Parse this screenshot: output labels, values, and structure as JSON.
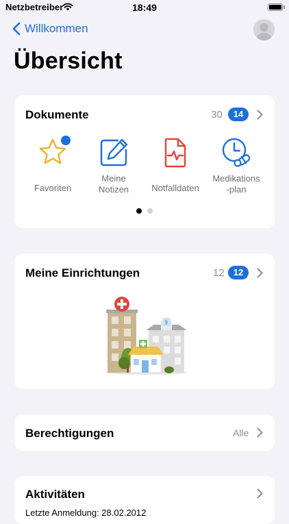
{
  "status": {
    "carrier": "Netzbetreiber",
    "time": "18:49"
  },
  "nav": {
    "back_label": "Willkommen"
  },
  "page": {
    "title": "Übersicht"
  },
  "documents": {
    "title": "Dokumente",
    "count": "30",
    "badge": "14",
    "tiles": [
      {
        "label": "Favoriten",
        "icon": "star-icon"
      },
      {
        "label": "Meine Notizen",
        "icon": "note-edit-icon"
      },
      {
        "label": "Notfalldaten",
        "icon": "emergency-document-icon"
      },
      {
        "label": "Medikations-plan",
        "icon": "medication-plan-icon"
      }
    ],
    "page_indicator": {
      "pages": 2,
      "current": 1
    }
  },
  "facilities": {
    "title": "Meine Einrichtungen",
    "count": "12",
    "badge": "12"
  },
  "permissions": {
    "title": "Berechtigungen",
    "value": "Alle"
  },
  "activities": {
    "title": "Aktivitäten",
    "last_login": "Letzte Anmeldung: 28.02.2012"
  },
  "colors": {
    "accent": "#1d6fd9",
    "emergency": "#e0453b",
    "star": "#f0b12b",
    "background": "#f2f2f7"
  }
}
